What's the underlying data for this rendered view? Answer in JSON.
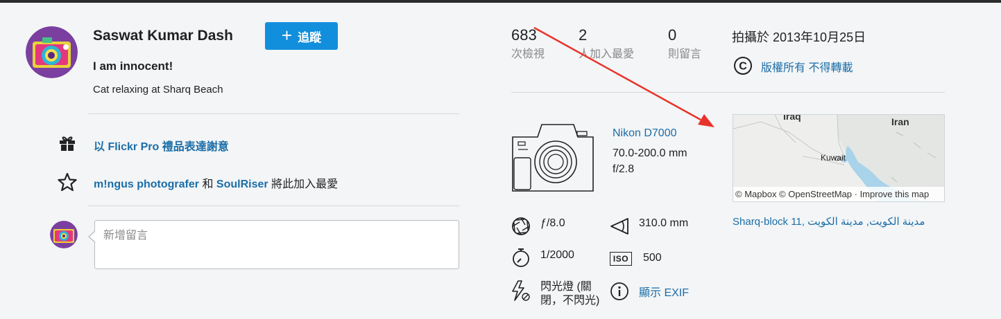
{
  "owner": {
    "name": "Saswat Kumar Dash",
    "follow_label": "追蹤",
    "follow_icon": "plus-icon"
  },
  "photo": {
    "title": "I am innocent!",
    "description": "Cat relaxing at Sharq Beach"
  },
  "actions": {
    "gift_label": "以 Flickr Pro 禮品表達謝意",
    "faves_user1": "m!ngus photografer",
    "faves_and": "和",
    "faves_user2": "SoulRiser",
    "faves_suffix": "將此加入最愛"
  },
  "comment": {
    "placeholder": "新增留言"
  },
  "stats": {
    "views_count": "683",
    "views_label": "次檢視",
    "faves_count": "2",
    "faves_label": "人加入最愛",
    "comments_count": "0",
    "comments_label": "則留言"
  },
  "meta": {
    "taken_on": "拍攝於 2013年10月25日",
    "license": "版權所有 不得轉載"
  },
  "camera": {
    "model": "Nikon D7000",
    "lens": "70.0-200.0 mm",
    "aperture_max": "f/2.8"
  },
  "exif": {
    "aperture": "ƒ/8.0",
    "focal_length": "310.0 mm",
    "shutter": "1/2000",
    "iso": "500",
    "iso_badge": "ISO",
    "flash": "閃光燈 (關閉，不閃光)",
    "show_exif": "顯示 EXIF"
  },
  "map": {
    "label_iraq": "Iraq",
    "label_iran": "Iran",
    "label_kuwait": "Kuwait",
    "attribution": "© Mapbox © OpenStreetMap · Improve this map",
    "location": "Sharq-block 11, مدينة الكويت, مدينة الكويت"
  },
  "colors": {
    "link": "#1b6da8",
    "follow_button": "#128fdc",
    "annotation_arrow": "#e8332a"
  }
}
